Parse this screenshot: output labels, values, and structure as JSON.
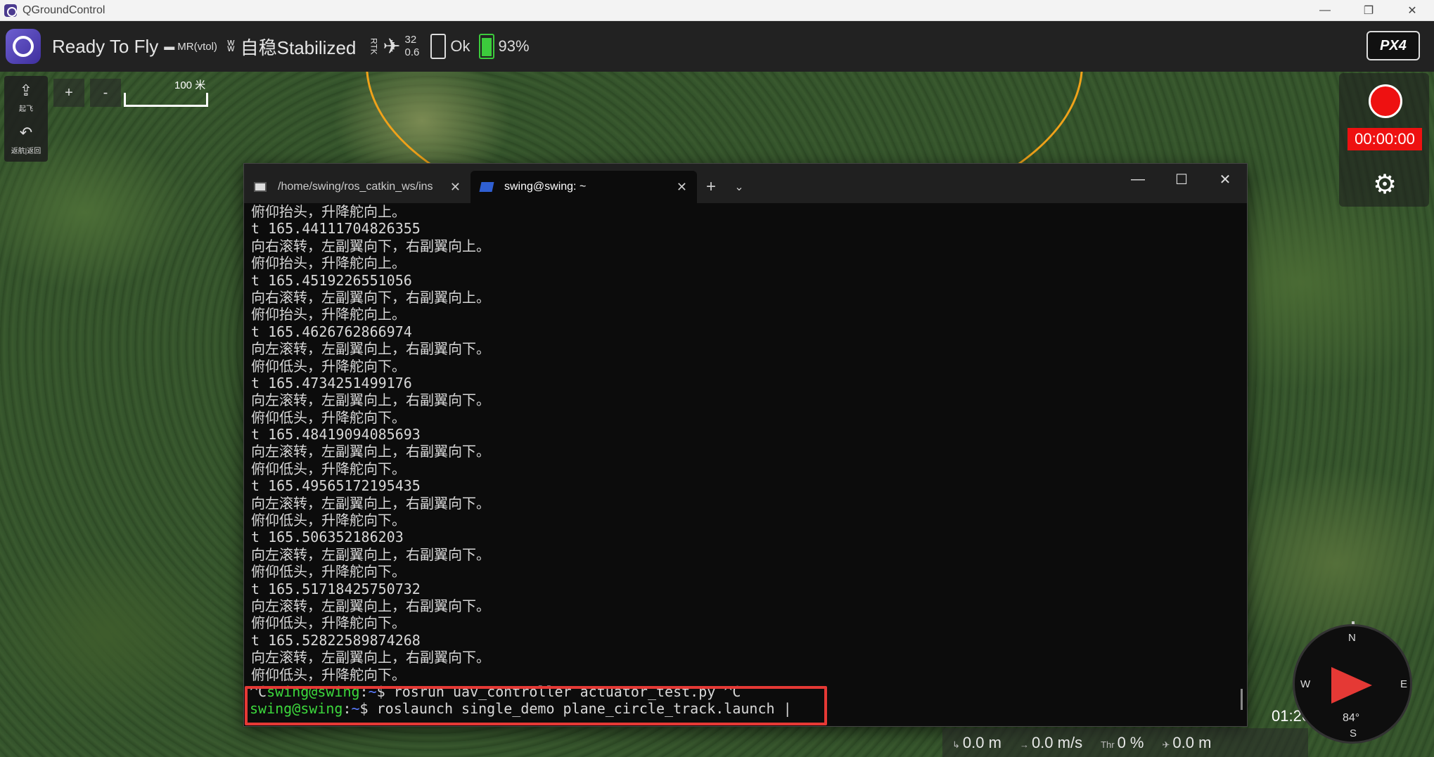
{
  "window": {
    "title": "QGroundControl",
    "minimize": "—",
    "restore": "❐",
    "close": "✕"
  },
  "toolbar": {
    "status": "Ready To Fly",
    "vehicle": "MR(vtol)",
    "flight_mode": "自稳Stabilized",
    "rtk_label": "RTK",
    "gps_sats": "32",
    "gps_hdop": "0.6",
    "battery_status": "Ok",
    "battery_percent": "93%",
    "px4_logo": "PX4"
  },
  "map": {
    "zoom_in": "+",
    "zoom_out": "-",
    "scale_label": "100 米",
    "tools": [
      {
        "icon": "takeoff-icon",
        "label": "起飞"
      },
      {
        "icon": "return-icon",
        "label": "返航|返回"
      }
    ]
  },
  "recording": {
    "time": "00:00:00"
  },
  "terminal": {
    "tabs": [
      {
        "label": "/home/swing/ros_catkin_ws/ins",
        "close": "✕"
      },
      {
        "label": "swing@swing: ~",
        "close": "✕"
      }
    ],
    "add_tab": "+",
    "dropdown": "⌄",
    "minimize": "—",
    "maximize": "☐",
    "close": "✕",
    "lines": [
      "俯仰抬头，升降舵向上。",
      "t 165.44111704826355",
      "向右滚转，左副翼向下，右副翼向上。",
      "俯仰抬头，升降舵向上。",
      "t 165.4519226551056",
      "向右滚转，左副翼向下，右副翼向上。",
      "俯仰抬头，升降舵向上。",
      "t 165.4626762866974",
      "向左滚转，左副翼向上，右副翼向下。",
      "俯仰低头，升降舵向下。",
      "t 165.4734251499176",
      "向左滚转，左副翼向上，右副翼向下。",
      "俯仰低头，升降舵向下。",
      "t 165.48419094085693",
      "向左滚转，左副翼向上，右副翼向下。",
      "俯仰低头，升降舵向下。",
      "t 165.49565172195435",
      "向左滚转，左副翼向上，右副翼向下。",
      "俯仰低头，升降舵向下。",
      "t 165.506352186203",
      "向左滚转，左副翼向上，右副翼向下。",
      "俯仰低头，升降舵向下。",
      "t 165.51718425750732",
      "向左滚转，左副翼向上，右副翼向下。",
      "俯仰低头，升降舵向下。",
      "t 165.52822589874268",
      "向左滚转，左副翼向上，右副翼向下。",
      "俯仰低头，升降舵向下。"
    ],
    "prompt1_prefix": "^C",
    "prompt_user": "swing@swing",
    "prompt_sep": ":",
    "prompt_path": "~",
    "prompt1_cmd": "$ rosrun uav_controller actuator_test.py ^C",
    "prompt2_cmd": "$ roslaunch single_demo plane_circle_track.launch |"
  },
  "telemetry": {
    "clock": "01:26",
    "altitude": "0.0 m",
    "speed": "0.0 m/s",
    "throttle_label": "Thr",
    "throttle": "0 %",
    "distance": "0.0 m"
  },
  "compass": {
    "n": "N",
    "s": "S",
    "e": "E",
    "w": "W",
    "heading": "84°"
  },
  "colors": {
    "prompt_green": "#3cd83c",
    "prompt_blue": "#5b7cff",
    "record_red": "#e11111",
    "highlight_red": "#e53935",
    "orbit_orange": "#f0a21a"
  }
}
